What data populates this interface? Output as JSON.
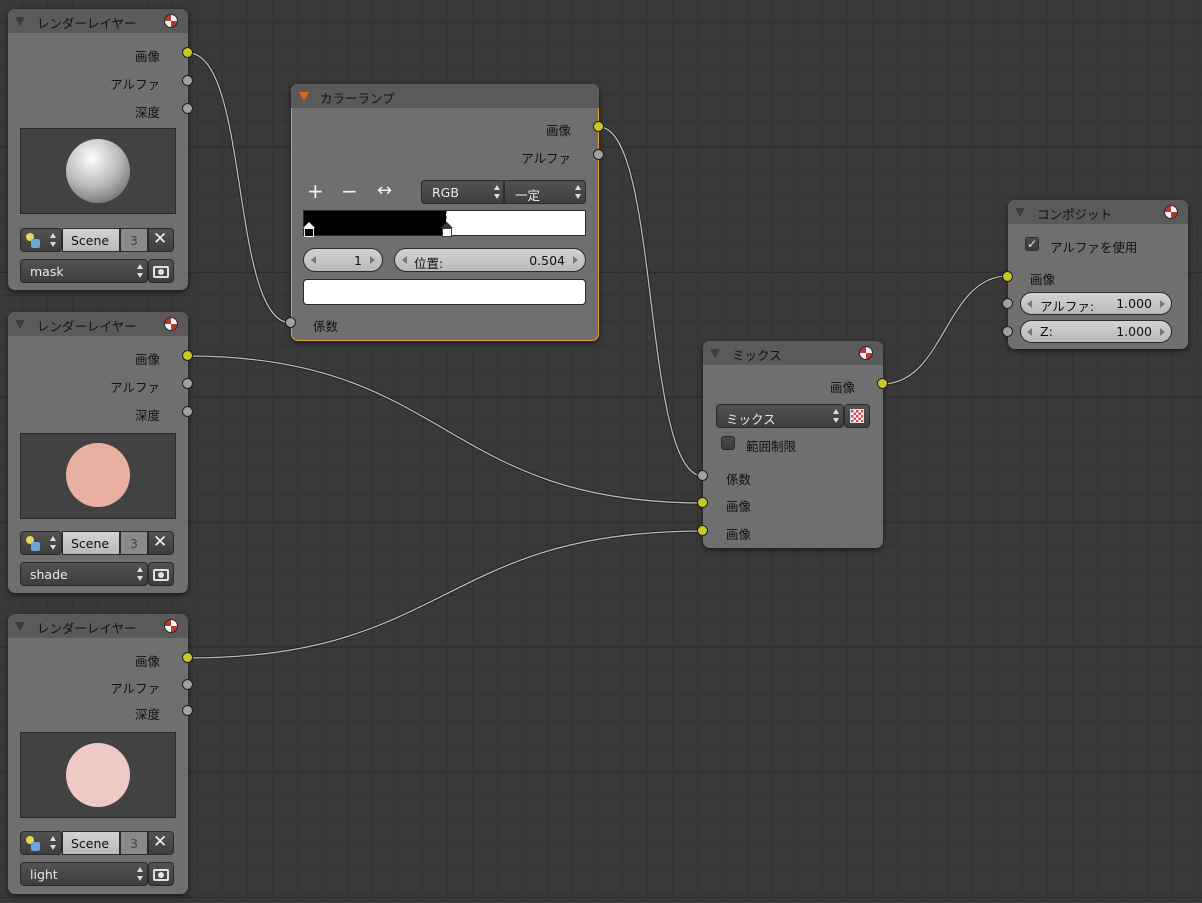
{
  "render_layer_nodes": [
    {
      "title": "レンダーレイヤー",
      "outputs": [
        "画像",
        "アルファ",
        "深度"
      ],
      "scene": "Scene",
      "layer_index": "3",
      "layer": "mask",
      "preview": "white-sphere"
    },
    {
      "title": "レンダーレイヤー",
      "outputs": [
        "画像",
        "アルファ",
        "深度"
      ],
      "scene": "Scene",
      "layer_index": "3",
      "layer": "shade",
      "preview": "salmon-disc",
      "preview_color": "#e9afa0"
    },
    {
      "title": "レンダーレイヤー",
      "outputs": [
        "画像",
        "アルファ",
        "深度"
      ],
      "scene": "Scene",
      "layer_index": "3",
      "layer": "light",
      "preview": "pink-disc",
      "preview_color": "#efc9c5"
    }
  ],
  "color_ramp_node": {
    "title": "カラーランプ",
    "outputs": [
      "画像",
      "アルファ"
    ],
    "add_symbol": "+",
    "remove_symbol": "−",
    "flip_symbol": "↔",
    "color_mode": "RGB",
    "interpolation": "一定",
    "stop_index": "1",
    "position_label": "位置:",
    "position_value": "0.504",
    "input": "係数",
    "stops": [
      {
        "position": 0.0,
        "color": "#000000"
      },
      {
        "position": 0.504,
        "color": "#ffffff"
      }
    ]
  },
  "mix_node": {
    "title": "ミックス",
    "output": "画像",
    "blend_type": "ミックス",
    "clamp_label": "範囲制限",
    "clamp": false,
    "inputs": [
      "係数",
      "画像",
      "画像"
    ]
  },
  "composite_node": {
    "title": "コンポジット",
    "use_alpha_label": "アルファを使用",
    "use_alpha": true,
    "input_image": "画像",
    "alpha_label": "アルファ:",
    "alpha_value": "1.000",
    "z_label": "Z:",
    "z_value": "1.000"
  },
  "colors": {
    "background": "#393939",
    "node_body": "#6f6f6f",
    "node_header": "#5a5a5a",
    "socket_color": "#c7c729",
    "socket_float": "#a0a0a0",
    "active_outline": "#e09a2d",
    "link": "#b9b9b9"
  }
}
